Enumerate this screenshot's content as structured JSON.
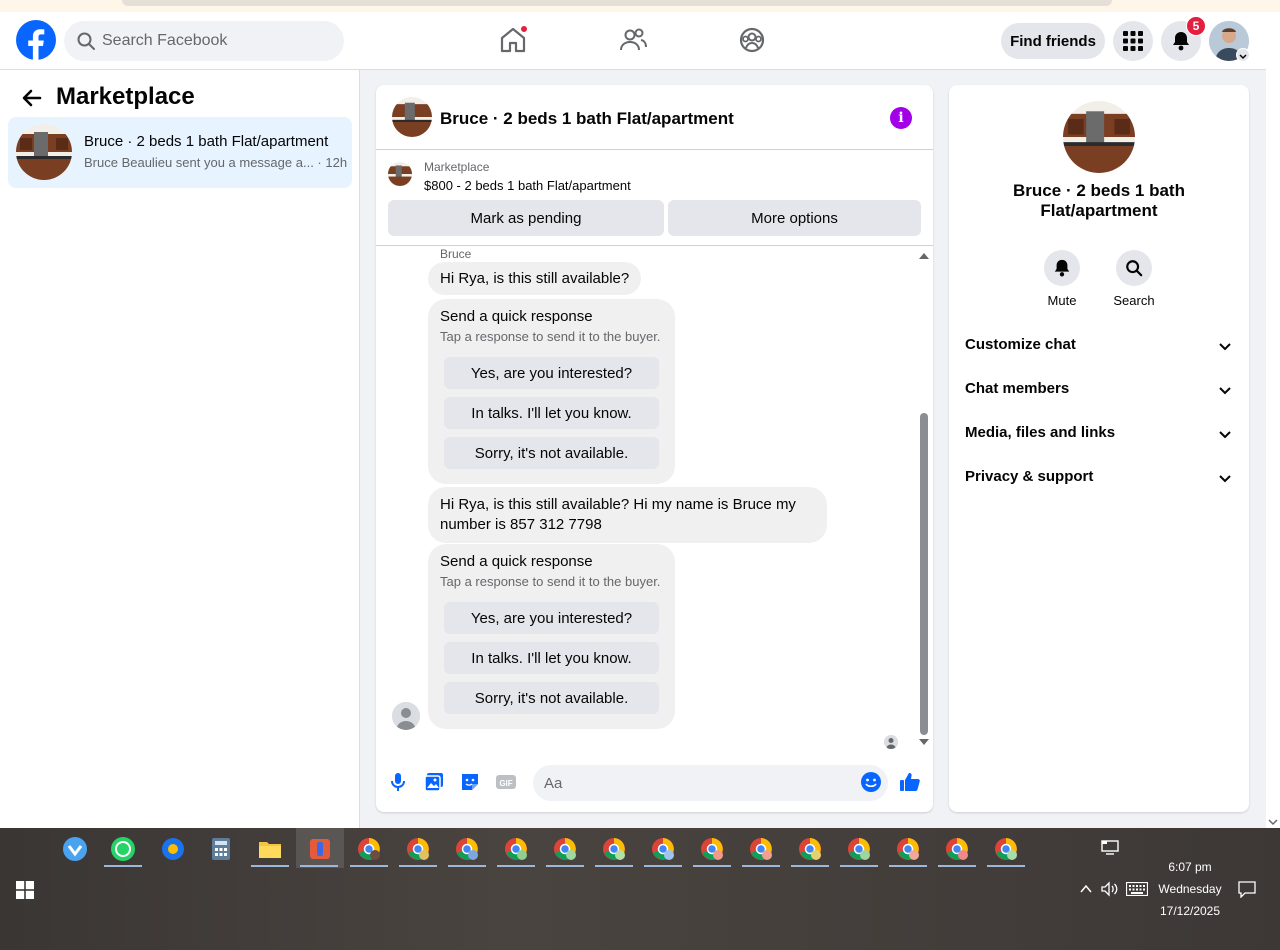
{
  "topnav": {
    "search_placeholder": "Search Facebook",
    "find_friends_label": "Find friends",
    "notification_count": "5"
  },
  "left": {
    "title": "Marketplace",
    "conversation": {
      "title": "Bruce · 2 beds 1 bath Flat/apartment",
      "subtitle": "Bruce Beaulieu sent you a message a... · 12h"
    }
  },
  "chat": {
    "header_title": "Bruce · 2 beds 1 bath Flat/apartment",
    "marketplace_label": "Marketplace",
    "listing_price": "$800 - 2 beds 1 bath Flat/apartment",
    "mark_pending_label": "Mark as pending",
    "more_options_label": "More options",
    "sender_name": "Bruce",
    "messages": [
      {
        "text": "Hi Rya, is this still available?"
      },
      {
        "text": "Hi Rya, is this still available? Hi my name is Bruce my number is 857 312 7798"
      }
    ],
    "quick_responses": [
      {
        "title": "Send a quick response",
        "subtitle": "Tap a response to send it to the buyer.",
        "options": [
          "Yes, are you interested?",
          "In talks. I'll let you know.",
          "Sorry, it's not available."
        ]
      },
      {
        "title": "Send a quick response",
        "subtitle": "Tap a response to send it to the buyer.",
        "options": [
          "Yes, are you interested?",
          "In talks. I'll let you know.",
          "Sorry, it's not available."
        ]
      }
    ],
    "composer_placeholder": "Aa"
  },
  "right": {
    "title": "Bruce · 2 beds 1 bath Flat/apartment",
    "mute_label": "Mute",
    "search_label": "Search",
    "sections": [
      "Customize chat",
      "Chat members",
      "Media, files and links",
      "Privacy & support"
    ]
  },
  "taskbar": {
    "time": "6:07 pm",
    "day": "Wednesday",
    "date": "17/12/2025"
  },
  "colors": {
    "brand_blue": "#0866ff",
    "info_purple": "#a200e6",
    "badge_red": "#e41e3f"
  }
}
